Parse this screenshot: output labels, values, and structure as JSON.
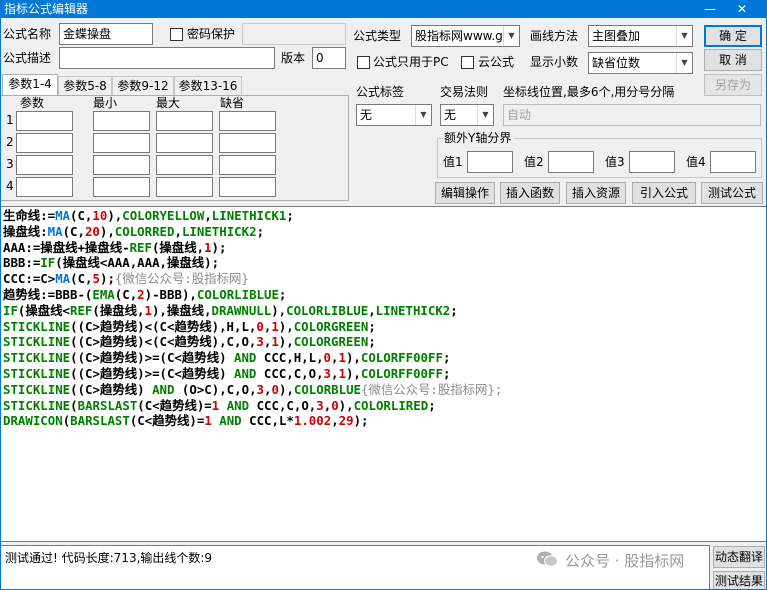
{
  "window": {
    "title": "指标公式编辑器",
    "minimize": "—",
    "close": "✕"
  },
  "form": {
    "name_label": "公式名称",
    "name_value": "金蝶操盘",
    "password_label": "密码保护",
    "desc_label": "公式描述",
    "version_label": "版本",
    "version_value": "0",
    "type_label": "公式类型",
    "type_value": "股指标网www.g",
    "draw_label": "画线方法",
    "draw_value": "主图叠加",
    "pc_only_label": "公式只用于PC",
    "cloud_label": "云公式",
    "decimal_label": "显示小数",
    "decimal_value": "缺省位数",
    "tag_label": "公式标签",
    "tag_value": "无",
    "trade_label": "交易法则",
    "trade_value": "无",
    "coord_label": "坐标线位置,最多6个,用分号分隔",
    "coord_placeholder": "自动"
  },
  "buttons": {
    "ok": "确 定",
    "cancel": "取 消",
    "save_as": "另存为"
  },
  "tabs": [
    "参数1-4",
    "参数5-8",
    "参数9-12",
    "参数13-16"
  ],
  "params": {
    "headers": [
      "参数",
      "最小",
      "最大",
      "缺省"
    ],
    "rows": [
      "1",
      "2",
      "3",
      "4"
    ]
  },
  "yaxis": {
    "title": "额外Y轴分界",
    "labels": [
      "值1",
      "值2",
      "值3",
      "值4"
    ]
  },
  "toolbar": [
    "编辑操作",
    "插入函数",
    "插入资源",
    "引入公式",
    "测试公式"
  ],
  "code_lines": [
    [
      [
        "生命线:=",
        "bk"
      ],
      [
        "MA",
        "bl"
      ],
      [
        "(C,",
        "bk"
      ],
      [
        "10",
        "rd"
      ],
      [
        "),",
        "bk"
      ],
      [
        "COLORYELLOW",
        "gn"
      ],
      [
        ",",
        "bk"
      ],
      [
        "LINETHICK1",
        "gn"
      ],
      [
        ";",
        "bk"
      ]
    ],
    [
      [
        "操盘线:",
        "bk"
      ],
      [
        "MA",
        "bl"
      ],
      [
        "(C,",
        "bk"
      ],
      [
        "20",
        "rd"
      ],
      [
        "),",
        "bk"
      ],
      [
        "COLORRED",
        "gn"
      ],
      [
        ",",
        "bk"
      ],
      [
        "LINETHICK2",
        "gn"
      ],
      [
        ";",
        "bk"
      ]
    ],
    [
      [
        "AAA:=操盘线+操盘线-",
        "bk"
      ],
      [
        "REF",
        "gn"
      ],
      [
        "(操盘线,",
        "bk"
      ],
      [
        "1",
        "rd"
      ],
      [
        ");",
        "bk"
      ]
    ],
    [
      [
        "BBB:=",
        "bk"
      ],
      [
        "IF",
        "gn"
      ],
      [
        "(操盘线<AAA,AAA,操盘线);",
        "bk"
      ]
    ],
    [
      [
        "CCC:=C>",
        "bk"
      ],
      [
        "MA",
        "bl"
      ],
      [
        "(C,",
        "bk"
      ],
      [
        "5",
        "rd"
      ],
      [
        ");",
        "bk"
      ],
      [
        "{微信公众号:股指标网}",
        "gr"
      ]
    ],
    [
      [
        "趋势线:=BBB-(",
        "bk"
      ],
      [
        "EMA",
        "gn"
      ],
      [
        "(C,",
        "bk"
      ],
      [
        "2",
        "rd"
      ],
      [
        ")-BBB),",
        "bk"
      ],
      [
        "COLORLIBLUE",
        "gn"
      ],
      [
        ";",
        "bk"
      ]
    ],
    [
      [
        "IF",
        "gn"
      ],
      [
        "(操盘线<",
        "bk"
      ],
      [
        "REF",
        "gn"
      ],
      [
        "(操盘线,",
        "bk"
      ],
      [
        "1",
        "rd"
      ],
      [
        "),操盘线,",
        "bk"
      ],
      [
        "DRAWNULL",
        "gn"
      ],
      [
        "),",
        "bk"
      ],
      [
        "COLORLIBLUE",
        "gn"
      ],
      [
        ",",
        "bk"
      ],
      [
        "LINETHICK2",
        "gn"
      ],
      [
        ";",
        "bk"
      ]
    ],
    [
      [
        "STICKLINE",
        "gn"
      ],
      [
        "((C>趋势线)<(C<趋势线),H,L,",
        "bk"
      ],
      [
        "0",
        "rd"
      ],
      [
        ",",
        "bk"
      ],
      [
        "1",
        "rd"
      ],
      [
        "),",
        "bk"
      ],
      [
        "COLORGREEN",
        "gn"
      ],
      [
        ";",
        "bk"
      ]
    ],
    [
      [
        "STICKLINE",
        "gn"
      ],
      [
        "((C>趋势线)<(C<趋势线),C,O,",
        "bk"
      ],
      [
        "3",
        "rd"
      ],
      [
        ",",
        "bk"
      ],
      [
        "1",
        "rd"
      ],
      [
        "),",
        "bk"
      ],
      [
        "COLORGREEN",
        "gn"
      ],
      [
        ";",
        "bk"
      ]
    ],
    [
      [
        "STICKLINE",
        "gn"
      ],
      [
        "((C>趋势线)>=(C<趋势线) ",
        "bk"
      ],
      [
        "AND",
        "gn"
      ],
      [
        " CCC,H,L,",
        "bk"
      ],
      [
        "0",
        "rd"
      ],
      [
        ",",
        "bk"
      ],
      [
        "1",
        "rd"
      ],
      [
        "),",
        "bk"
      ],
      [
        "COLORFF00FF",
        "gn"
      ],
      [
        ";",
        "bk"
      ]
    ],
    [
      [
        "STICKLINE",
        "gn"
      ],
      [
        "((C>趋势线)>=(C<趋势线) ",
        "bk"
      ],
      [
        "AND",
        "gn"
      ],
      [
        " CCC,C,O,",
        "bk"
      ],
      [
        "3",
        "rd"
      ],
      [
        ",",
        "bk"
      ],
      [
        "1",
        "rd"
      ],
      [
        "),",
        "bk"
      ],
      [
        "COLORFF00FF",
        "gn"
      ],
      [
        ";",
        "bk"
      ]
    ],
    [
      [
        "STICKLINE",
        "gn"
      ],
      [
        "((C>趋势线) ",
        "bk"
      ],
      [
        "AND",
        "gn"
      ],
      [
        " (O>C),C,O,",
        "bk"
      ],
      [
        "3",
        "rd"
      ],
      [
        ",",
        "bk"
      ],
      [
        "0",
        "rd"
      ],
      [
        "),",
        "bk"
      ],
      [
        "COLORBLUE",
        "gn"
      ],
      [
        "{微信公众号:股指标网};",
        "gr"
      ]
    ],
    [
      [
        "STICKLINE",
        "gn"
      ],
      [
        "(",
        "bk"
      ],
      [
        "BARSLAST",
        "gn"
      ],
      [
        "(C<趋势线)=",
        "bk"
      ],
      [
        "1",
        "rd"
      ],
      [
        " ",
        "bk"
      ],
      [
        "AND",
        "gn"
      ],
      [
        " CCC,C,O,",
        "bk"
      ],
      [
        "3",
        "rd"
      ],
      [
        ",",
        "bk"
      ],
      [
        "0",
        "rd"
      ],
      [
        "),",
        "bk"
      ],
      [
        "COLORLIRED",
        "gn"
      ],
      [
        ";",
        "bk"
      ]
    ],
    [
      [
        "DRAWICON",
        "gn"
      ],
      [
        "(",
        "bk"
      ],
      [
        "BARSLAST",
        "gn"
      ],
      [
        "(C<趋势线)=",
        "bk"
      ],
      [
        "1",
        "rd"
      ],
      [
        " ",
        "bk"
      ],
      [
        "AND",
        "gn"
      ],
      [
        " CCC,L*",
        "bk"
      ],
      [
        "1.002",
        "rd"
      ],
      [
        ",",
        "bk"
      ],
      [
        "29",
        "rd"
      ],
      [
        ");",
        "bk"
      ]
    ]
  ],
  "status": {
    "text": "测试通过! 代码长度:713,输出线个数:9"
  },
  "watermark": {
    "text": "公众号 · 股指标网"
  },
  "side_buttons": {
    "translate": "动态翻译",
    "test_result": "测试结果"
  }
}
